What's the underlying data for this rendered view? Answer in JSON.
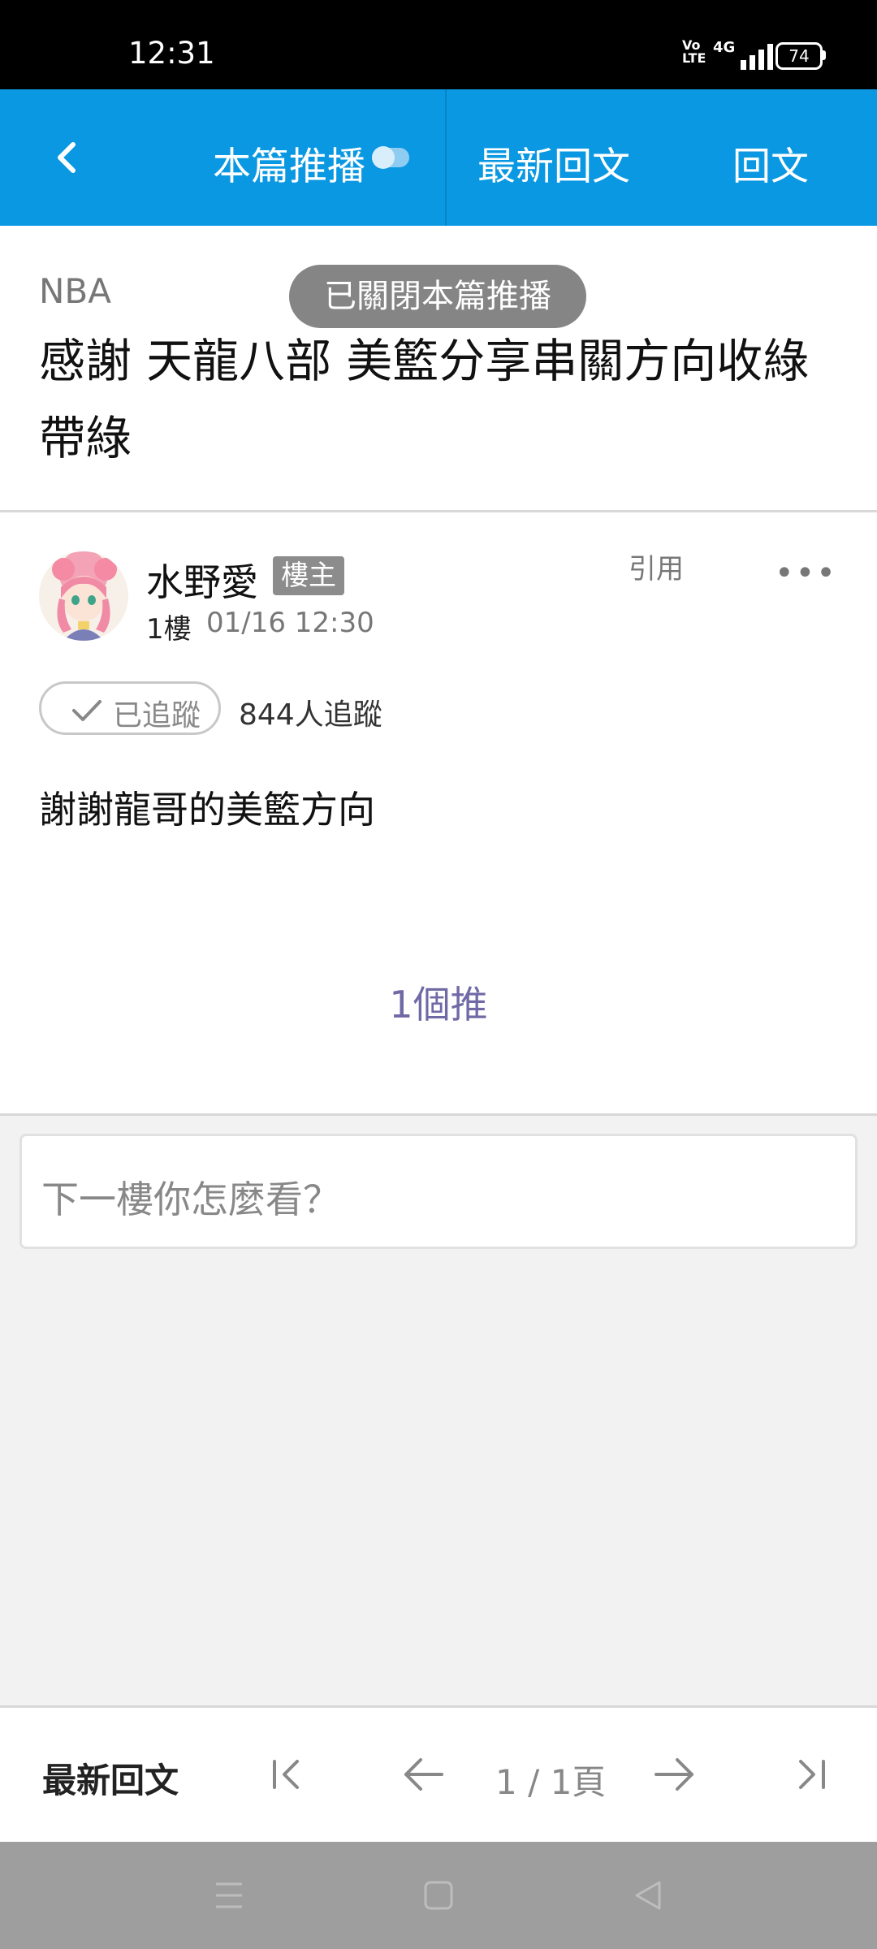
{
  "status_bar": {
    "time": "12:31",
    "volte": "Vo\nLTE",
    "network": "4G",
    "battery": "74"
  },
  "top_bar": {
    "push_label": "本篇推播",
    "latest_label": "最新回文",
    "reply_label": "回文"
  },
  "toast": "已關閉本篇推播",
  "thread": {
    "board": "NBA",
    "title": "感謝 天龍八部 美籃分享串關方向收綠帶綠"
  },
  "post": {
    "author": "水野愛",
    "op_badge": "樓主",
    "floor": "1樓",
    "time": "01/16 12:30",
    "quote_label": "引用",
    "more_label": "•••",
    "follow_label": "已追蹤",
    "follow_count": "844人追蹤",
    "content": "謝謝龍哥的美籃方向",
    "push_count": "1個推"
  },
  "comment_input": {
    "placeholder": "下一樓你怎麼看？"
  },
  "bottom_bar": {
    "latest_label": "最新回文",
    "page_indicator": "1 / 1頁"
  },
  "colors": {
    "accent": "#0a98e2",
    "push_count": "#6f6aa6"
  }
}
